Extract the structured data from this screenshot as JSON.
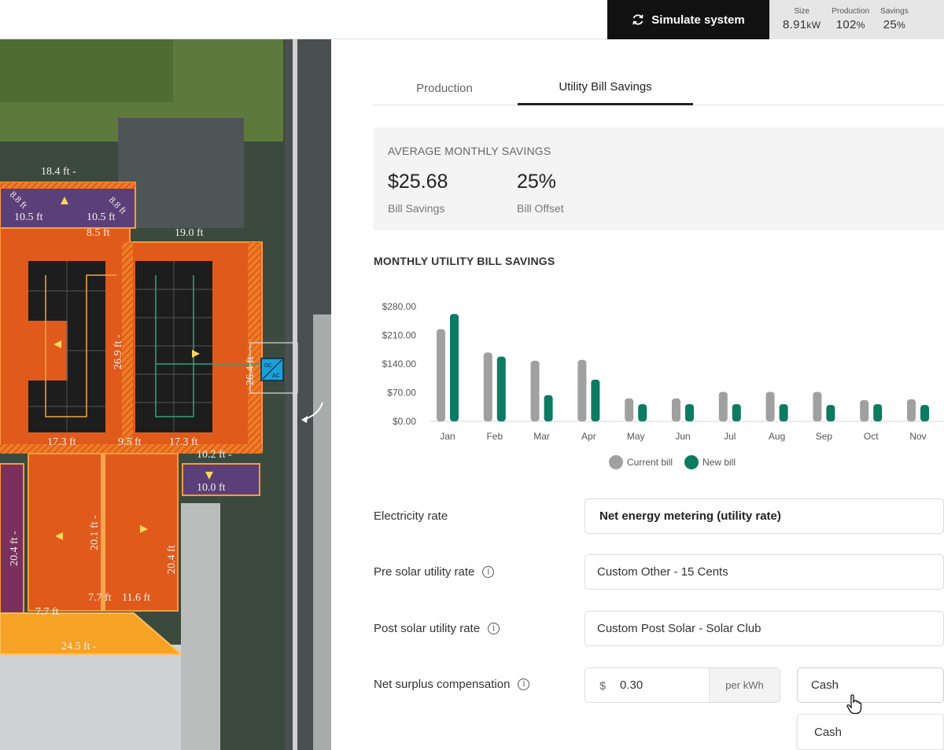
{
  "toolbar": {
    "simulate_label": "Simulate system",
    "stats": [
      {
        "label": "Size",
        "value": "8.91",
        "unit": "kW"
      },
      {
        "label": "Production",
        "value": "102",
        "unit": "%"
      },
      {
        "label": "Savings",
        "value": "25",
        "unit": "%"
      }
    ]
  },
  "map": {
    "dimensions": [
      "18.4 ft -",
      "10.5 ft",
      "10.5 ft",
      "8.8 ft",
      "8.8 ft",
      "8.5 ft",
      "19.0 ft",
      "26.9 ft -",
      "26.4 ft",
      "17.3 ft",
      "9.5 ft",
      "17.3 ft",
      "10.2 ft -",
      "10.0 ft",
      "20.4 ft -",
      "20.1 ft -",
      "20.4 ft",
      "7.7 ft",
      "11.6 ft",
      "7.7 ft",
      "24.5 ft -"
    ],
    "inverter_label_top": "DC",
    "inverter_label_bottom": "AC"
  },
  "tabs": [
    {
      "label": "Production",
      "active": false
    },
    {
      "label": "Utility Bill Savings",
      "active": true
    }
  ],
  "summary": {
    "title": "AVERAGE MONTHLY SAVINGS",
    "bill_savings_value": "$25.68",
    "bill_savings_label": "Bill Savings",
    "bill_offset_value": "25%",
    "bill_offset_label": "Bill Offset"
  },
  "chart_title": "MONTHLY UTILITY BILL SAVINGS",
  "chart_data": {
    "type": "bar",
    "title": "MONTHLY UTILITY BILL SAVINGS",
    "categories": [
      "Jan",
      "Feb",
      "Mar",
      "Apr",
      "May",
      "Jun",
      "Jul",
      "Aug",
      "Sep",
      "Oct",
      "Nov"
    ],
    "series": [
      {
        "name": "Current bill",
        "color": "#a0a0a0",
        "values": [
          225,
          168,
          148,
          150,
          56,
          56,
          72,
          72,
          72,
          52,
          54
        ]
      },
      {
        "name": "New bill",
        "color": "#0d7a62",
        "values": [
          262,
          158,
          64,
          102,
          42,
          42,
          42,
          42,
          40,
          42,
          40
        ]
      }
    ],
    "yticks": [
      "$0.00",
      "$70.00",
      "$140.00",
      "$210.00",
      "$280.00"
    ],
    "ytick_values": [
      0,
      70,
      140,
      210,
      280
    ],
    "ylim": [
      0,
      280
    ],
    "legend_position": "bottom-center",
    "grid": false
  },
  "form": {
    "electricity_rate": {
      "label": "Electricity rate",
      "value": "Net energy metering (utility rate)"
    },
    "pre_solar": {
      "label": "Pre solar utility rate",
      "value": "Custom Other - 15 Cents"
    },
    "post_solar": {
      "label": "Post solar utility rate",
      "value": "Custom Post Solar - Solar Club"
    },
    "net_surplus": {
      "label": "Net surplus compensation",
      "prefix": "$",
      "value": "0.30",
      "suffix": "per kWh",
      "select_value": "Cash"
    },
    "dropdown_options": [
      "Cash"
    ]
  },
  "colors": {
    "accent": "#0d7a62",
    "current": "#a0a0a0",
    "roof": "#e0561c"
  }
}
